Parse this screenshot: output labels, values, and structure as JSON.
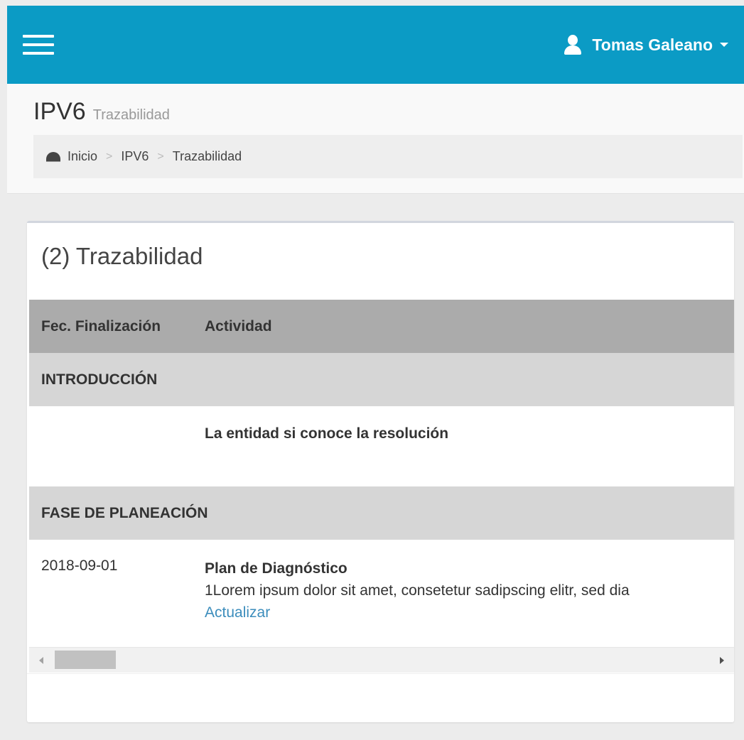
{
  "colors": {
    "navbar": "#0b9bc5",
    "link": "#3c8dbc",
    "header_row": "#ababab",
    "section_row": "#d6d6d6"
  },
  "navbar": {
    "menu_icon": "hamburger-icon",
    "user": {
      "icon": "user-icon",
      "name": "Tomas Galeano"
    }
  },
  "header": {
    "title": "IPV6",
    "subtitle": "Trazabilidad",
    "breadcrumb": {
      "icon": "dashboard-icon",
      "items": [
        "Inicio",
        "IPV6",
        "Trazabilidad"
      ],
      "separator": ">"
    }
  },
  "box": {
    "title": "(2) Trazabilidad",
    "table": {
      "columns": [
        "Fec. Finalización",
        "Actividad"
      ],
      "sections": [
        {
          "name": "INTRODUCCIÓN",
          "rows": [
            {
              "date": "",
              "activity": "La entidad si conoce la resolución"
            }
          ]
        },
        {
          "name": "FASE DE PLANEACIÓN",
          "rows": [
            {
              "date": "2018-09-01",
              "activity": "Plan de Diagnóstico",
              "description": "1Lorem ipsum dolor sit amet, consetetur sadipscing elitr, sed dia",
              "action": "Actualizar"
            }
          ]
        }
      ]
    }
  }
}
